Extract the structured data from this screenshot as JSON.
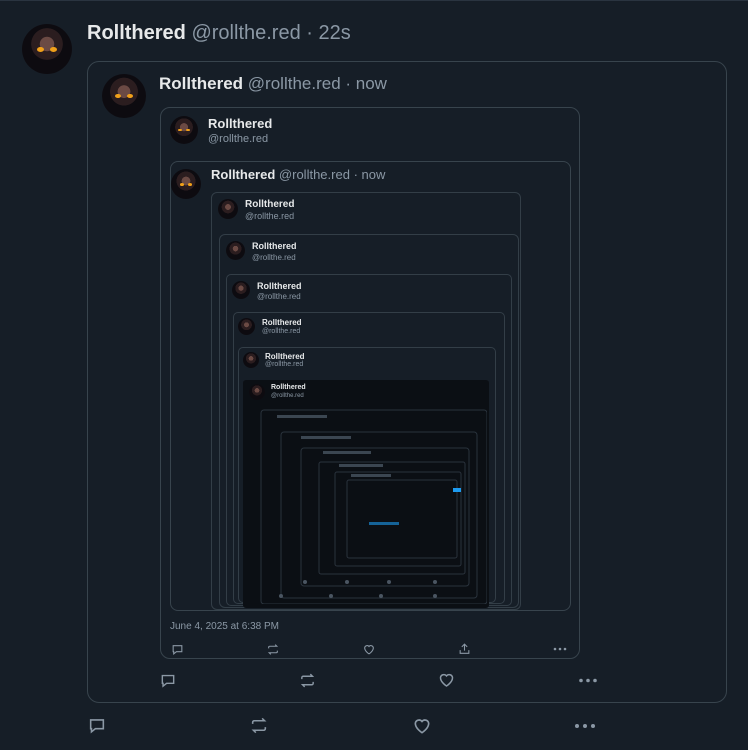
{
  "post": {
    "name": "Rollthered",
    "handle": "@rollthe.red",
    "time": "· 22s"
  },
  "quote1": {
    "name": "Rollthered",
    "handle": "@rollthe.red",
    "time": "· now"
  },
  "quote2": {
    "name": "Rollthered",
    "handle": "@rollthe.red"
  },
  "quote3": {
    "name": "Rollthered",
    "handle": "@rollthe.red",
    "time": "· now"
  },
  "nested": [
    {
      "name": "Rollthered",
      "handle": "@rollthe.red"
    },
    {
      "name": "Rollthered",
      "handle": "@rollthe.red"
    },
    {
      "name": "Rollthered",
      "handle": "@rollthe.red"
    },
    {
      "name": "Rollthered",
      "handle": "@rollthe.red"
    },
    {
      "name": "Rollthered",
      "handle": "@rollthe.red"
    },
    {
      "name": "Rollthered",
      "handle": "@rollthe.red"
    }
  ],
  "inner_date": "June 4, 2025 at 6:38 PM",
  "icons": {
    "reply": "reply-icon",
    "repost": "repost-icon",
    "like": "heart-icon",
    "share": "share-icon",
    "more": "more-icon"
  },
  "colors": {
    "background": "#161e27",
    "border": "#38444d",
    "muted": "#8b98a5"
  }
}
